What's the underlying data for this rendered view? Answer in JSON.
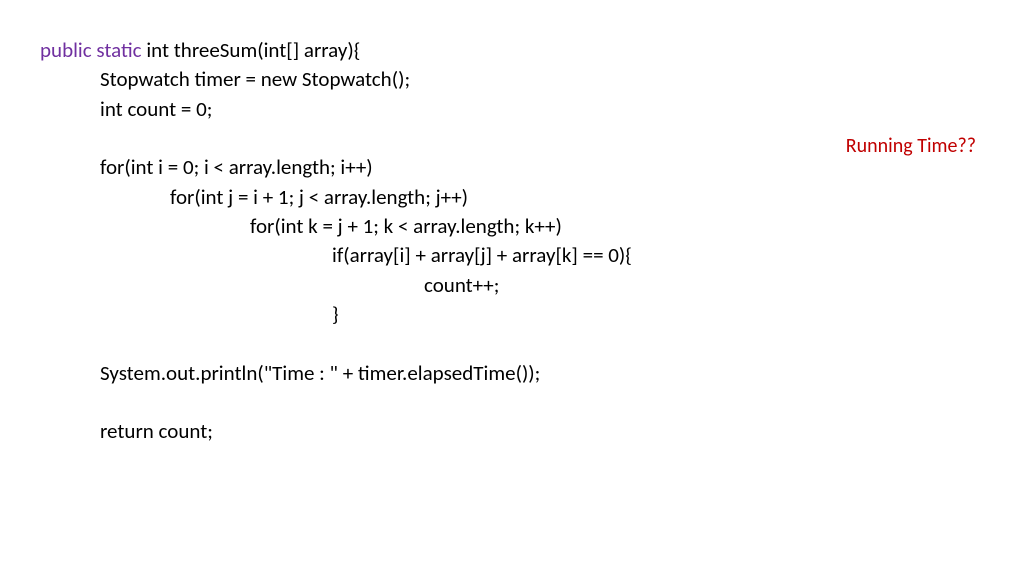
{
  "code": {
    "keyword": "public static ",
    "signature": "int threeSum(int[] array){",
    "line1": "Stopwatch timer = new Stopwatch();",
    "line2": "int count = 0;",
    "line3": "for(int i = 0; i < array.length; i++)",
    "line4": "for(int j = i + 1; j < array.length; j++)",
    "line5": "for(int k = j + 1; k < array.length; k++)",
    "line6": "if(array[i] + array[j] + array[k] == 0){",
    "line7": "count++;",
    "line8": "}",
    "line9": "System.out.println(\"Time : \" + timer.elapsedTime());",
    "line10": "return count;"
  },
  "annotation": "Running Time??"
}
